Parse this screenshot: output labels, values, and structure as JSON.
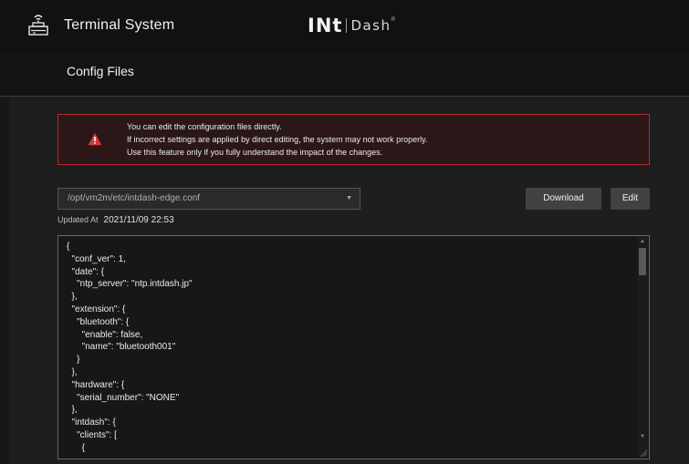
{
  "app": {
    "title": "Terminal System",
    "icon": "terminal-device-icon"
  },
  "logo": {
    "int": "INt",
    "dash": "Dash",
    "reg": "®"
  },
  "page": {
    "title": "Config Files"
  },
  "alert": {
    "icon": "warning-icon",
    "color": "#b3262f",
    "lines": [
      "You can edit the configuration files directly.",
      "If incorrect settings are applied by direct editing, the system may not work properly.",
      "Use this feature only if you fully understand the impact of the changes."
    ]
  },
  "file_select": {
    "value": "/opt/vm2m/etc/intdash-edge.conf"
  },
  "buttons": {
    "download": "Download",
    "edit": "Edit"
  },
  "updated": {
    "label": "Updated At",
    "value": "2021/11/09 22:53"
  },
  "editor": {
    "lines": [
      "{",
      "  \"conf_ver\": 1,",
      "  \"date\": {",
      "    \"ntp_server\": \"ntp.intdash.jp\"",
      "  },",
      "  \"extension\": {",
      "    \"bluetooth\": {",
      "      \"enable\": false,",
      "      \"name\": \"bluetooth001\"",
      "    }",
      "  },",
      "  \"hardware\": {",
      "    \"serial_number\": \"NONE\"",
      "  },",
      "  \"intdash\": {",
      "    \"clients\": [",
      "      {"
    ]
  },
  "colors": {
    "background": "#1e1e1e",
    "topbar": "#111111",
    "button": "#424242",
    "alert_bg": "#2b1718"
  }
}
